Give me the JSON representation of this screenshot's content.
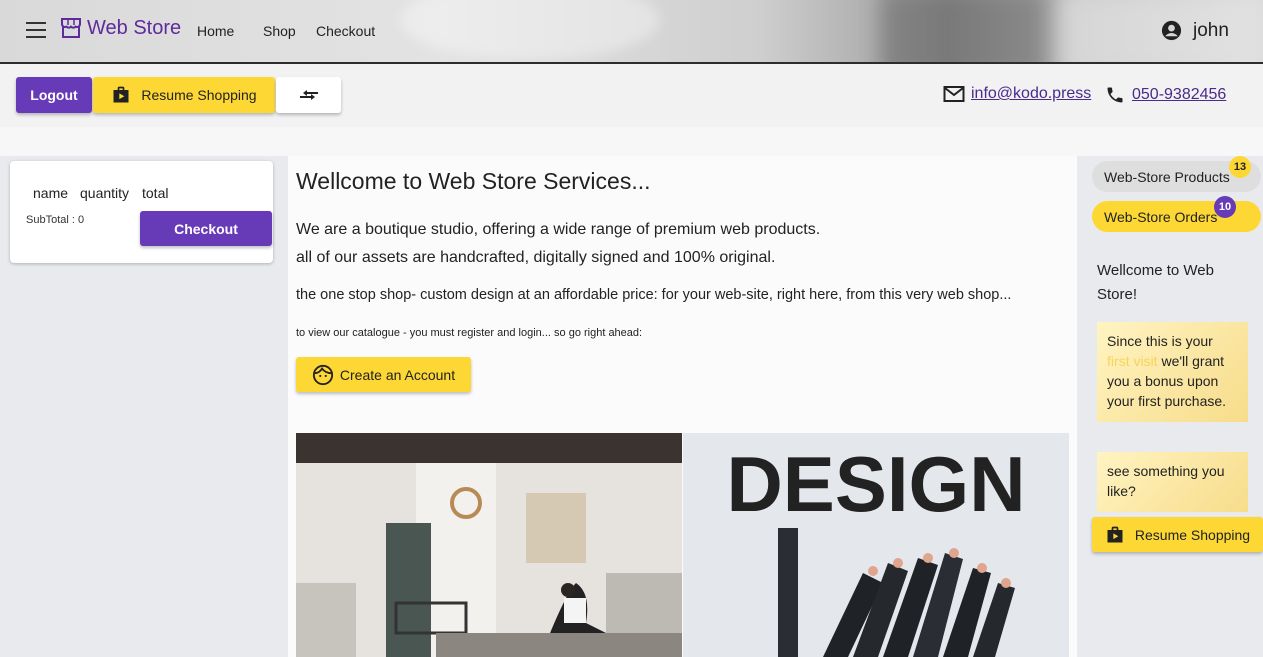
{
  "appbar": {
    "brand": "Web Store",
    "nav": [
      "Home",
      "Shop",
      "Checkout"
    ],
    "username": "john"
  },
  "toolbar": {
    "logout_label": "Logout",
    "resume_label": "Resume Shopping",
    "email": "info@kodo.press",
    "phone": "050-9382456"
  },
  "cart": {
    "columns": [
      "name",
      "quantity",
      "total"
    ],
    "subtotal": "SubTotal : 0",
    "checkout_label": "Checkout"
  },
  "main": {
    "title": "Wellcome to Web Store Services...",
    "line1": "We are a boutique studio, offering a wide range of premium web products.",
    "line2": "all of our assets are handcrafted, digitally signed and 100% original.",
    "line3": "the one stop shop- custom design at an affordable price: for your web-site, right here, from this very web shop...",
    "line4": "to view our catalogue - you must register and login... so go right ahead:",
    "create_account_label": "Create an Account",
    "design_text": "DESIGN"
  },
  "sidebar": {
    "products_label": "Web-Store Products",
    "products_count": "13",
    "orders_label": "Web-Store Orders",
    "orders_count": "10",
    "welcome_text": "Wellcome to Web Store!",
    "note1_before": "Since this is your",
    "note1_highlight": "first visit",
    "note1_after": "we'll grant you a bonus upon your first purchase.",
    "note2": "see something you like?",
    "resume_label": "Resume Shopping"
  },
  "colors": {
    "primary": "#673ab7",
    "accent": "#fdd835",
    "link": "#4a2a8a"
  }
}
